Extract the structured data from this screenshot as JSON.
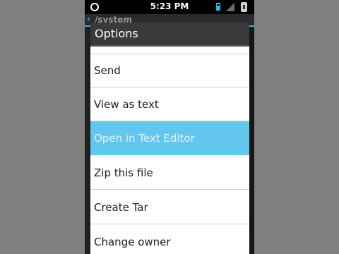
{
  "status_bar": {
    "time": "5:23 PM"
  },
  "behind": {
    "back_icon": "‹",
    "path": "/system"
  },
  "dialog": {
    "title": "Options",
    "items": [
      {
        "label": "Send",
        "highlighted": false
      },
      {
        "label": "View as text",
        "highlighted": false
      },
      {
        "label": "Open in Text Editor",
        "highlighted": true
      },
      {
        "label": "Zip this file",
        "highlighted": false
      },
      {
        "label": "Create Tar",
        "highlighted": false
      },
      {
        "label": "Change owner",
        "highlighted": false
      }
    ]
  },
  "colors": {
    "accent": "#33b5e5",
    "highlight": "#62c6ee",
    "dialog_title_bg": "#3a3a3a"
  }
}
